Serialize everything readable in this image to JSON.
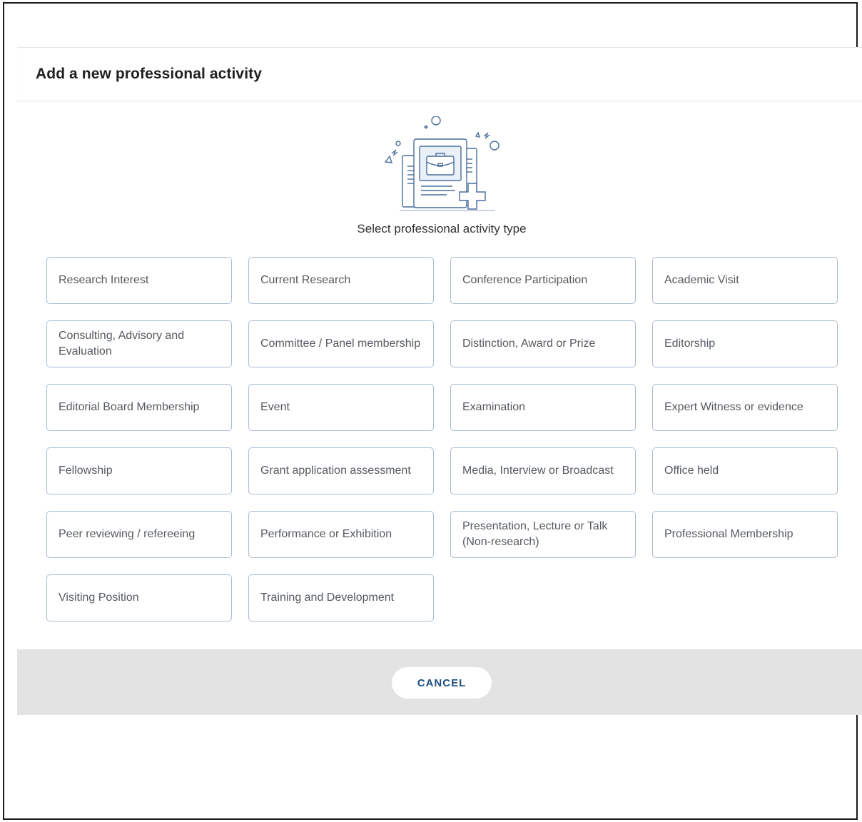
{
  "dialog": {
    "title": "Add a new professional activity",
    "subtitle": "Select professional activity type",
    "illustration_icon": "briefcase-document-add-icon",
    "cancel_label": "CANCEL"
  },
  "activity_types": [
    {
      "label": "Research Interest"
    },
    {
      "label": "Current Research"
    },
    {
      "label": "Conference Participation"
    },
    {
      "label": "Academic Visit"
    },
    {
      "label": "Consulting, Advisory and Evaluation"
    },
    {
      "label": "Committee / Panel membership"
    },
    {
      "label": "Distinction, Award or Prize"
    },
    {
      "label": "Editorship"
    },
    {
      "label": "Editorial Board Membership"
    },
    {
      "label": "Event"
    },
    {
      "label": "Examination"
    },
    {
      "label": "Expert Witness or evidence"
    },
    {
      "label": "Fellowship"
    },
    {
      "label": "Grant application assessment"
    },
    {
      "label": "Media, Interview or Broadcast"
    },
    {
      "label": "Office held"
    },
    {
      "label": "Peer reviewing / refereeing"
    },
    {
      "label": "Performance or Exhibition"
    },
    {
      "label": "Presentation, Lecture or Talk (Non-research)"
    },
    {
      "label": "Professional Membership"
    },
    {
      "label": "Visiting Position"
    },
    {
      "label": "Training and Development"
    }
  ],
  "colors": {
    "card_border": "#a9bcd3",
    "card_text": "#555a60",
    "footer_bg": "#e3e3e3",
    "cancel_text": "#1f4f7f",
    "illustration_stroke": "#4a6d9a"
  }
}
